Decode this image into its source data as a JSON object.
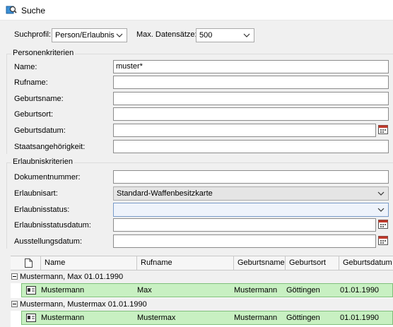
{
  "window": {
    "title": "Suche"
  },
  "top": {
    "profile_label": "Suchprofil:",
    "profile_value": "Person/Erlaubnis",
    "max_label": "Max. Datensätze:",
    "max_value": "500"
  },
  "person": {
    "legend": "Personenkriterien",
    "name_label": "Name:",
    "name_value": "muster*",
    "rufname_label": "Rufname:",
    "rufname_value": "",
    "geburtsname_label": "Geburtsname:",
    "geburtsname_value": "",
    "geburtsort_label": "Geburtsort:",
    "geburtsort_value": "",
    "geburtsdatum_label": "Geburtsdatum:",
    "geburtsdatum_value": "",
    "staat_label": "Staatsangehörigkeit:",
    "staat_value": ""
  },
  "erlaubnis": {
    "legend": "Erlaubniskriterien",
    "dok_label": "Dokumentnummer:",
    "dok_value": "",
    "art_label": "Erlaubnisart:",
    "art_value": "Standard-Waffenbesitzkarte",
    "status_label": "Erlaubnisstatus:",
    "status_value": "",
    "statusdatum_label": "Erlaubnisstatusdatum:",
    "statusdatum_value": "",
    "ausstellung_label": "Ausstellungsdatum:",
    "ausstellung_value": ""
  },
  "results": {
    "columns": [
      "Name",
      "Rufname",
      "Geburtsname",
      "Geburtsort",
      "Geburtsdatum"
    ],
    "groups": [
      {
        "label": "Mustermann, Max 01.01.1990",
        "row": {
          "name": "Mustermann",
          "rufname": "Max",
          "geburtsname": "Mustermann",
          "geburtsort": "Göttingen",
          "geburtsdatum": "01.01.1990"
        }
      },
      {
        "label": "Mustermann, Mustermax 01.01.1990",
        "row": {
          "name": "Mustermann",
          "rufname": "Mustermax",
          "geburtsname": "Mustermann",
          "geburtsort": "Göttingen",
          "geburtsdatum": "01.01.1990"
        }
      }
    ]
  },
  "icons": {
    "app": "search-app-icon",
    "calendar": "calendar-icon",
    "document": "document-icon",
    "person_card": "person-card-icon"
  },
  "colors": {
    "row_highlight": "#c8f0c2",
    "row_border": "#7fbf7a"
  }
}
